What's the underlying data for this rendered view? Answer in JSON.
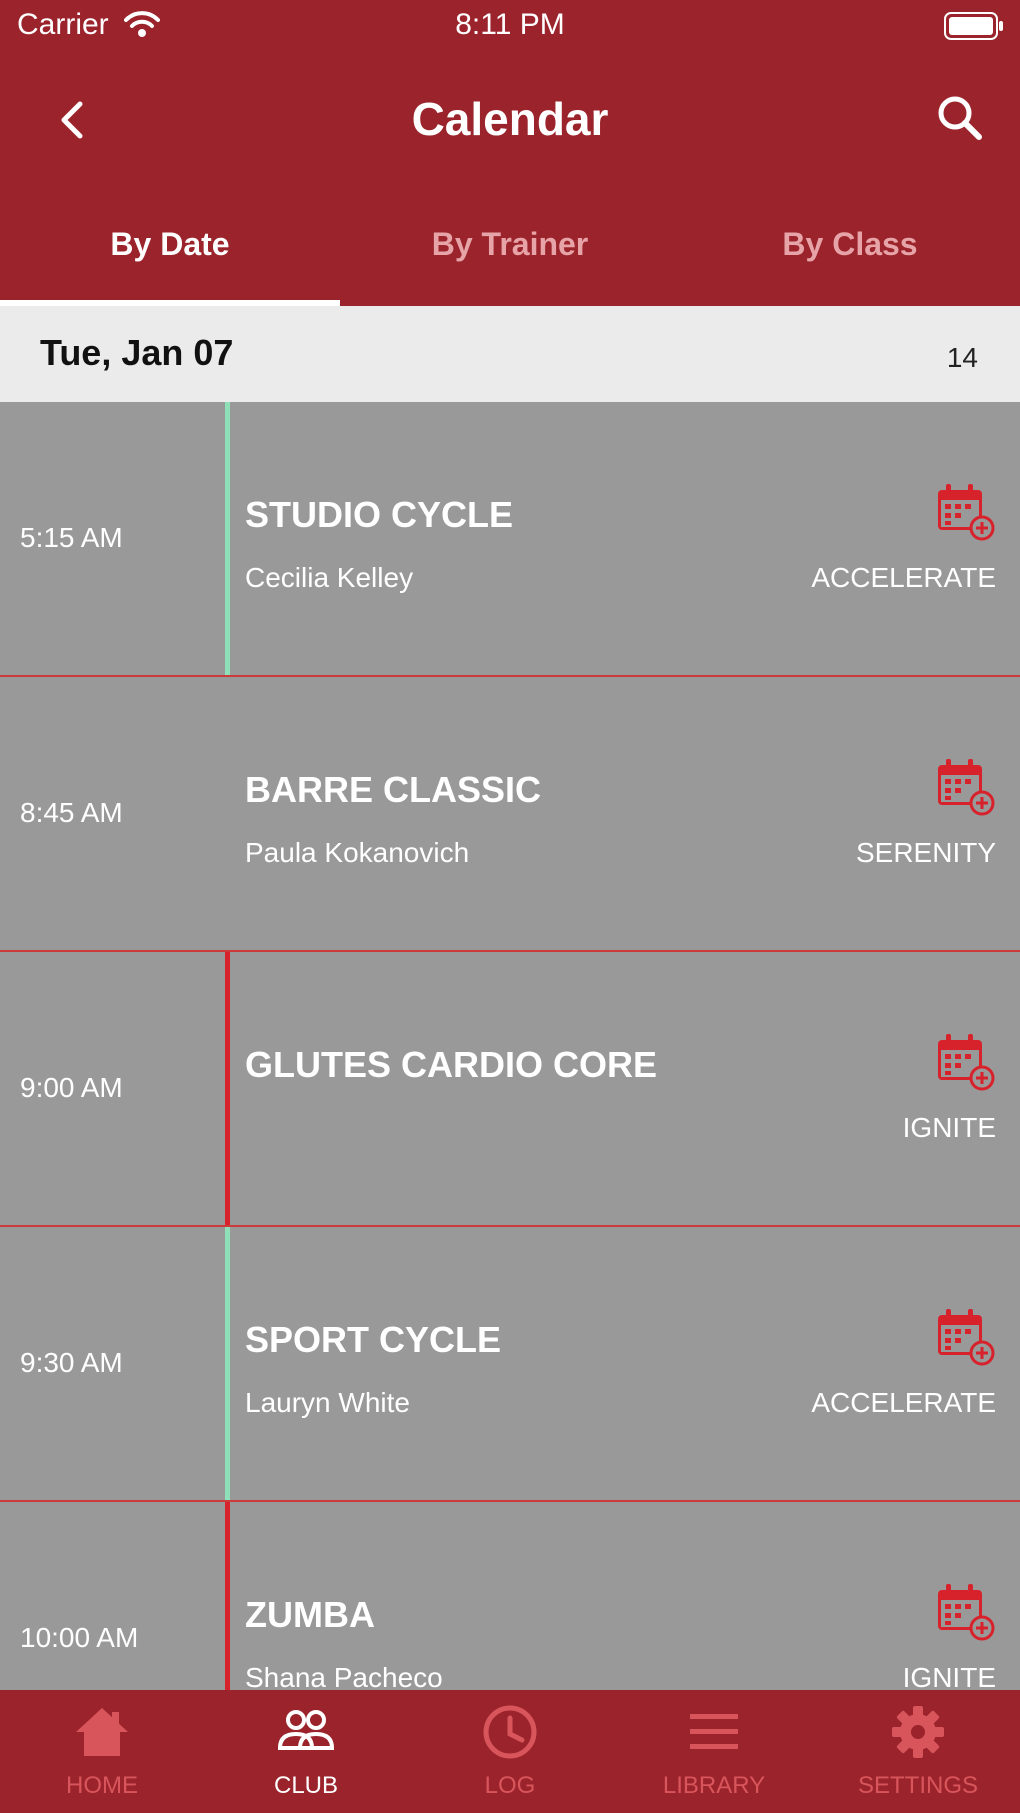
{
  "status_bar": {
    "carrier": "Carrier",
    "time": "8:11 PM"
  },
  "header": {
    "title": "Calendar"
  },
  "tabs": [
    {
      "label": "By Date",
      "active": true
    },
    {
      "label": "By Trainer",
      "active": false
    },
    {
      "label": "By Class",
      "active": false
    }
  ],
  "date_bar": {
    "date": "Tue, Jan 07",
    "count": "14"
  },
  "classes": [
    {
      "time": "5:15 AM",
      "name": "STUDIO CYCLE",
      "trainer": "Cecilia Kelley",
      "studio": "ACCELERATE",
      "accent": "green"
    },
    {
      "time": "8:45 AM",
      "name": "BARRE CLASSIC",
      "trainer": "Paula Kokanovich",
      "studio": "SERENITY",
      "accent": "none"
    },
    {
      "time": "9:00 AM",
      "name": "GLUTES CARDIO CORE",
      "trainer": "",
      "studio": "IGNITE",
      "accent": "red"
    },
    {
      "time": "9:30 AM",
      "name": "SPORT CYCLE",
      "trainer": "Lauryn White",
      "studio": "ACCELERATE",
      "accent": "green"
    },
    {
      "time": "10:00 AM",
      "name": "ZUMBA",
      "trainer": "Shana Pacheco",
      "studio": "IGNITE",
      "accent": "red"
    }
  ],
  "tabbar": [
    {
      "label": "HOME",
      "icon": "home-icon",
      "active": false
    },
    {
      "label": "CLUB",
      "icon": "club-icon",
      "active": true
    },
    {
      "label": "LOG",
      "icon": "clock-icon",
      "active": false
    },
    {
      "label": "LIBRARY",
      "icon": "menu-icon",
      "active": false
    },
    {
      "label": "SETTINGS",
      "icon": "gear-icon",
      "active": false
    }
  ],
  "colors": {
    "brand": "#9b232b",
    "accent_green": "#8ee0b8",
    "accent_red": "#d8222b",
    "row_bg": "#999999",
    "tab_inactive": "#d9555c"
  }
}
